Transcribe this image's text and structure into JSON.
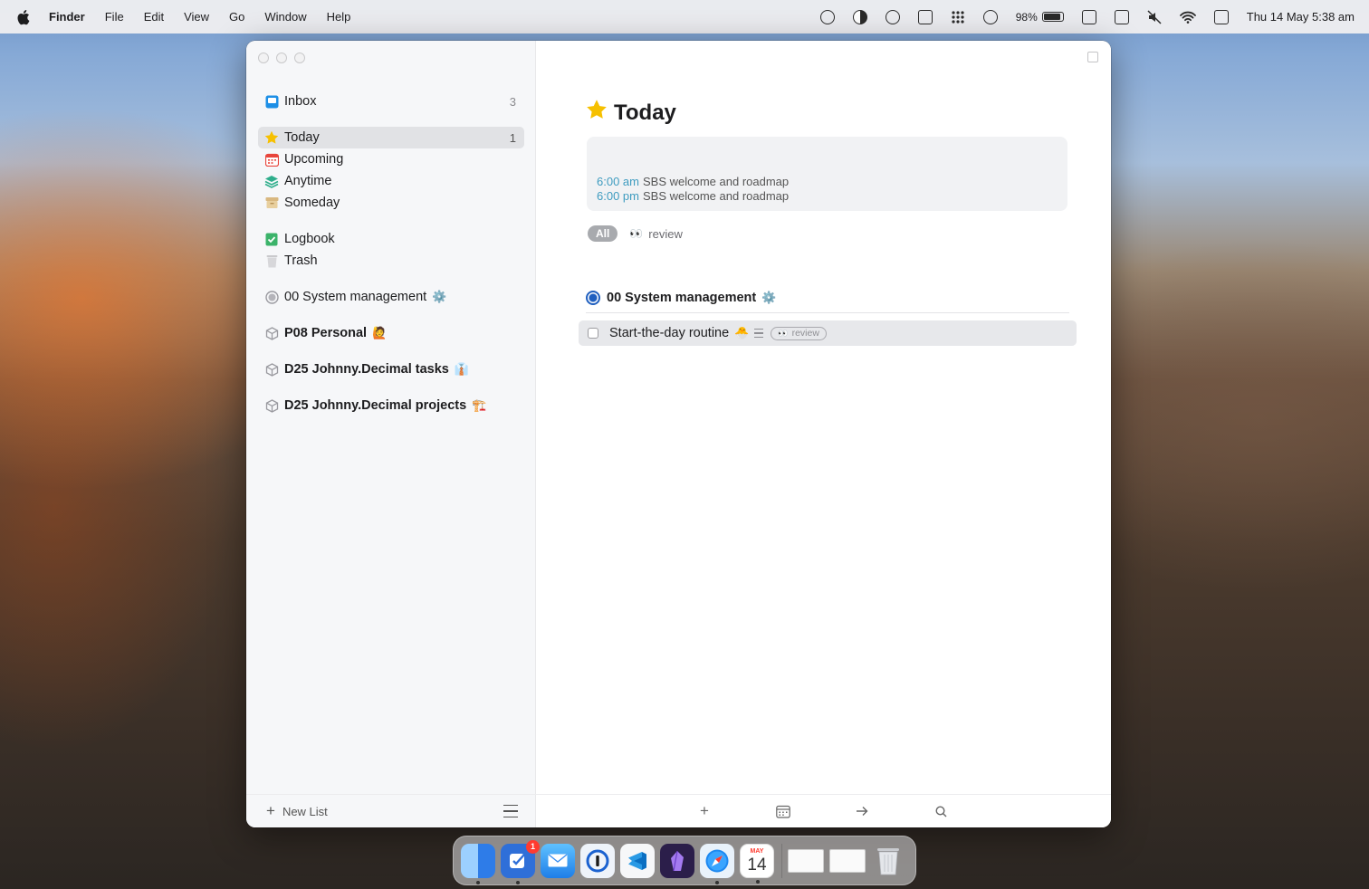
{
  "menubar": {
    "app_name": "Finder",
    "menus": [
      "File",
      "Edit",
      "View",
      "Go",
      "Window",
      "Help"
    ],
    "battery_percent": "98%",
    "datetime": "Thu 14 May  5:38 am",
    "status_icons": [
      "screen-share-icon",
      "dark-mode-icon",
      "time-machine-icon",
      "shield-icon",
      "grid-icon",
      "sync-icon",
      "battery-icon",
      "sidebar-icon",
      "window-icon",
      "mute-icon",
      "wifi-icon",
      "control-center-icon"
    ]
  },
  "sidebar": {
    "items": [
      {
        "label": "Inbox",
        "count": "3",
        "icon": "inbox-icon"
      },
      {
        "label": "Today",
        "count": "1",
        "icon": "star-icon"
      },
      {
        "label": "Upcoming",
        "icon": "calendar-icon"
      },
      {
        "label": "Anytime",
        "icon": "stack-icon"
      },
      {
        "label": "Someday",
        "icon": "box-icon"
      },
      {
        "label": "Logbook",
        "icon": "logbook-check-icon"
      },
      {
        "label": "Trash",
        "icon": "trash-icon"
      },
      {
        "label": "00 System management",
        "emoji": "⚙️",
        "icon": "area-circle-icon"
      },
      {
        "label": "P08 Personal",
        "emoji": "🙋",
        "icon": "area-cube-icon"
      },
      {
        "label": "D25 Johnny.Decimal tasks",
        "emoji": "👔",
        "icon": "area-cube-icon"
      },
      {
        "label": "D25 Johnny.Decimal projects",
        "emoji": "🏗️",
        "icon": "area-cube-icon"
      }
    ],
    "footer": {
      "new_list_label": "New List"
    }
  },
  "main": {
    "title": "Today",
    "calendar_events": [
      {
        "time": "6:00 am",
        "title": "SBS welcome and roadmap"
      },
      {
        "time": "6:00 pm",
        "title": "SBS welcome and roadmap"
      }
    ],
    "filter_tags": {
      "all_label": "All",
      "review_eyes": "👀",
      "review_label": "review"
    },
    "group": {
      "title": "00 System management",
      "emoji": "⚙️"
    },
    "tasks": [
      {
        "title": "Start-the-day routine",
        "emoji": "🐣",
        "tag_eyes": "👀",
        "tag": "review"
      }
    ]
  },
  "dock": {
    "apps": [
      {
        "name": "Finder",
        "icon": "finder-icon",
        "color": "#3a8ef0"
      },
      {
        "name": "Things",
        "icon": "things-icon",
        "color": "#2f6fd8",
        "badge": "1"
      },
      {
        "name": "Mail",
        "icon": "mail-icon",
        "color": "#3aa0f5"
      },
      {
        "name": "1Password",
        "icon": "onepassword-icon",
        "color": "#1b62d0"
      },
      {
        "name": "VS Code",
        "icon": "vscode-icon",
        "color": "#f5f5f5"
      },
      {
        "name": "Obsidian",
        "icon": "obsidian-icon",
        "color": "#2b1e4a"
      },
      {
        "name": "Safari",
        "icon": "safari-icon",
        "color": "#1e88f0"
      },
      {
        "name": "Calendar",
        "icon": "calendar-app-icon",
        "color": "#ffffff",
        "month": "MAY",
        "day": "14"
      }
    ]
  }
}
